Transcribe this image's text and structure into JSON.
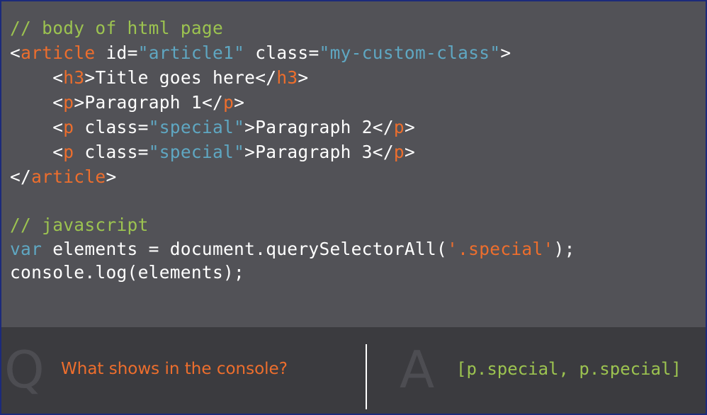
{
  "code": {
    "html_comment": "// body of html page",
    "article_open": {
      "lt": "<",
      "tag": "article",
      "sp1": " ",
      "attr1": "id=",
      "val1": "\"article1\"",
      "sp2": " ",
      "attr2": "class=",
      "val2": "\"my-custom-class\"",
      "gt": ">"
    },
    "h3_line": {
      "indent": "    ",
      "lt": "<",
      "tag_open": "h3",
      "gt": ">",
      "text": "Title goes here",
      "close_lt": "</",
      "tag_close": "h3",
      "close_gt": ">"
    },
    "p1_line": {
      "indent": "    ",
      "lt": "<",
      "tag_open": "p",
      "gt": ">",
      "text": "Paragraph 1",
      "close_lt": "</",
      "tag_close": "p",
      "close_gt": ">"
    },
    "p2_line": {
      "indent": "    ",
      "lt": "<",
      "tag_open": "p",
      "sp": " ",
      "attr": "class=",
      "val": "\"special\"",
      "gt": ">",
      "text": "Paragraph 2",
      "close_lt": "</",
      "tag_close": "p",
      "close_gt": ">"
    },
    "p3_line": {
      "indent": "    ",
      "lt": "<",
      "tag_open": "p",
      "sp": " ",
      "attr": "class=",
      "val": "\"special\"",
      "gt": ">",
      "text": "Paragraph 3",
      "close_lt": "</",
      "tag_close": "p",
      "close_gt": ">"
    },
    "article_close": {
      "lt": "</",
      "tag": "article",
      "gt": ">"
    },
    "js_comment": "// javascript",
    "js_line1": {
      "keyword": "var",
      "mid": " elements = document.querySelectorAll(",
      "string": "'.special'",
      "end": ");"
    },
    "js_line2": "console.log(elements);"
  },
  "qa": {
    "q_letter": "Q",
    "question": "What shows in the console?",
    "a_letter": "A",
    "answer": "[p.special, p.special]"
  },
  "colors": {
    "background": "#525257",
    "qa_bar": "#3b3b3f",
    "comment": "#9cc350",
    "tag": "#ed6e2d",
    "attr_value": "#5fa7c2",
    "text": "#ffffff",
    "border": "#1c2a7a"
  }
}
